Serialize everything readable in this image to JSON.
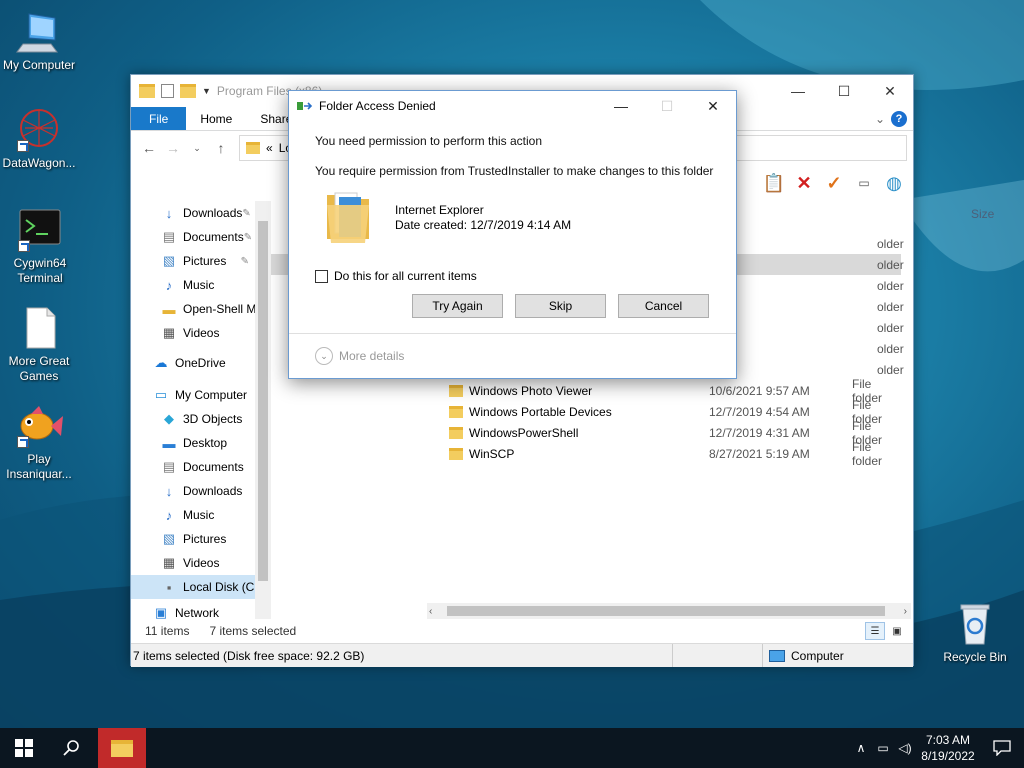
{
  "desktop": {
    "icons": [
      {
        "label": "My Computer"
      },
      {
        "label": "DataWagon..."
      },
      {
        "label": "Cygwin64 Terminal"
      },
      {
        "label": "More Great Games"
      },
      {
        "label": "Play Insaniquar..."
      },
      {
        "label": "Recycle Bin"
      }
    ]
  },
  "explorer": {
    "title": "Program Files (x86)",
    "ribbon_tabs": [
      "File",
      "Home",
      "Share"
    ],
    "address_prefix": "«",
    "address_text": "Lo",
    "column_size": "Size",
    "nav_items": [
      {
        "label": "Downloads",
        "icon": "download-arrow-icon",
        "pinned": true
      },
      {
        "label": "Documents",
        "icon": "document-icon",
        "pinned": true
      },
      {
        "label": "Pictures",
        "icon": "picture-icon",
        "pinned": true
      },
      {
        "label": "Music",
        "icon": "music-note-icon",
        "pinned": false
      },
      {
        "label": "Open-Shell Mod",
        "icon": "folder-icon",
        "pinned": false
      },
      {
        "label": "Videos",
        "icon": "video-icon",
        "pinned": false
      },
      {
        "label": "OneDrive",
        "icon": "cloud-icon",
        "pinned": false
      },
      {
        "label": "My Computer",
        "icon": "computer-icon",
        "pinned": false
      },
      {
        "label": "3D Objects",
        "icon": "cube-icon",
        "pinned": false
      },
      {
        "label": "Desktop",
        "icon": "desktop-icon",
        "pinned": false
      },
      {
        "label": "Documents",
        "icon": "document-icon",
        "pinned": false
      },
      {
        "label": "Downloads",
        "icon": "download-arrow-icon",
        "pinned": false
      },
      {
        "label": "Music",
        "icon": "music-note-icon",
        "pinned": false
      },
      {
        "label": "Pictures",
        "icon": "picture-icon",
        "pinned": false
      },
      {
        "label": "Videos",
        "icon": "video-icon",
        "pinned": false
      },
      {
        "label": "Local Disk (C:)",
        "icon": "drive-icon",
        "pinned": false
      },
      {
        "label": "Network",
        "icon": "network-icon",
        "pinned": false
      }
    ],
    "partial_rows": [
      {
        "type": "older"
      },
      {
        "type": "older",
        "selected": true
      },
      {
        "type": "older"
      },
      {
        "type": "older"
      },
      {
        "type": "older"
      },
      {
        "type": "older"
      },
      {
        "type": "older"
      }
    ],
    "partial_type_text": "older",
    "files": [
      {
        "name": "Windows Photo Viewer",
        "date": "10/6/2021 9:57 AM",
        "type": "File folder"
      },
      {
        "name": "Windows Portable Devices",
        "date": "12/7/2019 4:54 AM",
        "type": "File folder"
      },
      {
        "name": "WindowsPowerShell",
        "date": "12/7/2019 4:31 AM",
        "type": "File folder"
      },
      {
        "name": "WinSCP",
        "date": "8/27/2021 5:19 AM",
        "type": "File folder"
      }
    ],
    "status_items": "11 items",
    "status_selected": "7 items selected",
    "status_bar_text": "7 items selected (Disk free space: 92.2 GB)",
    "status_location": "Computer"
  },
  "dialog": {
    "title": "Folder Access Denied",
    "heading": "You need permission to perform this action",
    "message": "You require permission from TrustedInstaller to make changes to this folder",
    "item_name": "Internet Explorer",
    "item_date": "Date created: 12/7/2019 4:14 AM",
    "checkbox_label": "Do this for all current items",
    "buttons": {
      "try_again": "Try Again",
      "skip": "Skip",
      "cancel": "Cancel"
    },
    "more_details": "More details"
  },
  "taskbar": {
    "time": "7:03 AM",
    "date": "8/19/2022"
  }
}
